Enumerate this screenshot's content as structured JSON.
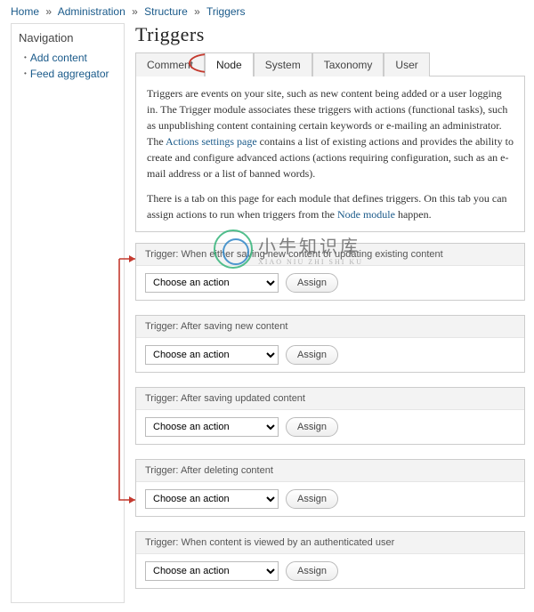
{
  "breadcrumb": {
    "home": "Home",
    "admin": "Administration",
    "structure": "Structure",
    "triggers": "Triggers"
  },
  "sidebar": {
    "heading": "Navigation",
    "items": [
      {
        "label": "Add content"
      },
      {
        "label": "Feed aggregator"
      }
    ]
  },
  "page_title": "Triggers",
  "tab_labels": {
    "comment": "Comment",
    "node": "Node",
    "system": "System",
    "taxonomy": "Taxonomy",
    "user": "User"
  },
  "intro": {
    "p1a": "Triggers are events on your site, such as new content being added or a user logging in. The Trigger module associates these triggers with actions (functional tasks), such as unpublishing content containing certain keywords or e-mailing an administrator. The ",
    "link1": "Actions settings page",
    "p1b": " contains a list of existing actions and provides the ability to create and configure advanced actions (actions requiring configuration, such as an e-mail address or a list of banned words).",
    "p2a": "There is a tab on this page for each module that defines triggers. On this tab you can assign actions to run when triggers from the ",
    "link2": "Node module",
    "p2b": " happen."
  },
  "action_option": "Choose an action",
  "assign_label": "Assign",
  "triggers": [
    {
      "head": "Trigger: When either saving new content or updating existing content"
    },
    {
      "head": "Trigger: After saving new content"
    },
    {
      "head": "Trigger: After saving updated content"
    },
    {
      "head": "Trigger: After deleting content"
    },
    {
      "head": "Trigger: When content is viewed by an authenticated user"
    }
  ],
  "watermark": {
    "big": "小牛知识库",
    "small": "XIAO NIU ZHI SHI KU"
  }
}
